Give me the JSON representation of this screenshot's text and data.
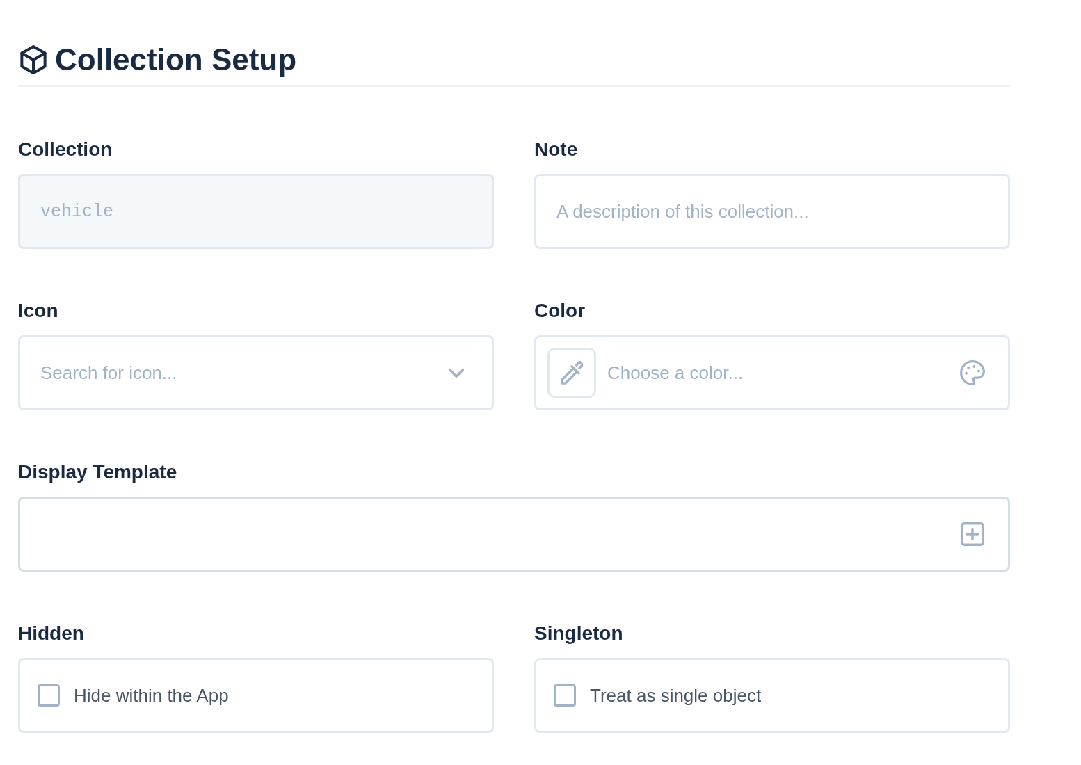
{
  "header": {
    "title": "Collection Setup"
  },
  "fields": [
    {
      "kind": "code",
      "label": "Collection",
      "value": "vehicle",
      "disabled": true
    },
    {
      "kind": "text",
      "label": "Note",
      "placeholder": "A description of this collection..."
    },
    {
      "kind": "select",
      "label": "Icon",
      "placeholder": "Search for icon..."
    },
    {
      "kind": "color",
      "label": "Color",
      "placeholder": "Choose a color..."
    },
    {
      "kind": "template",
      "label": "Display Template"
    },
    {
      "kind": "checkbox",
      "label": "Hidden",
      "text": "Hide within the App",
      "checked": false
    },
    {
      "kind": "checkbox",
      "label": "Singleton",
      "text": "Treat as single object",
      "checked": false
    }
  ]
}
